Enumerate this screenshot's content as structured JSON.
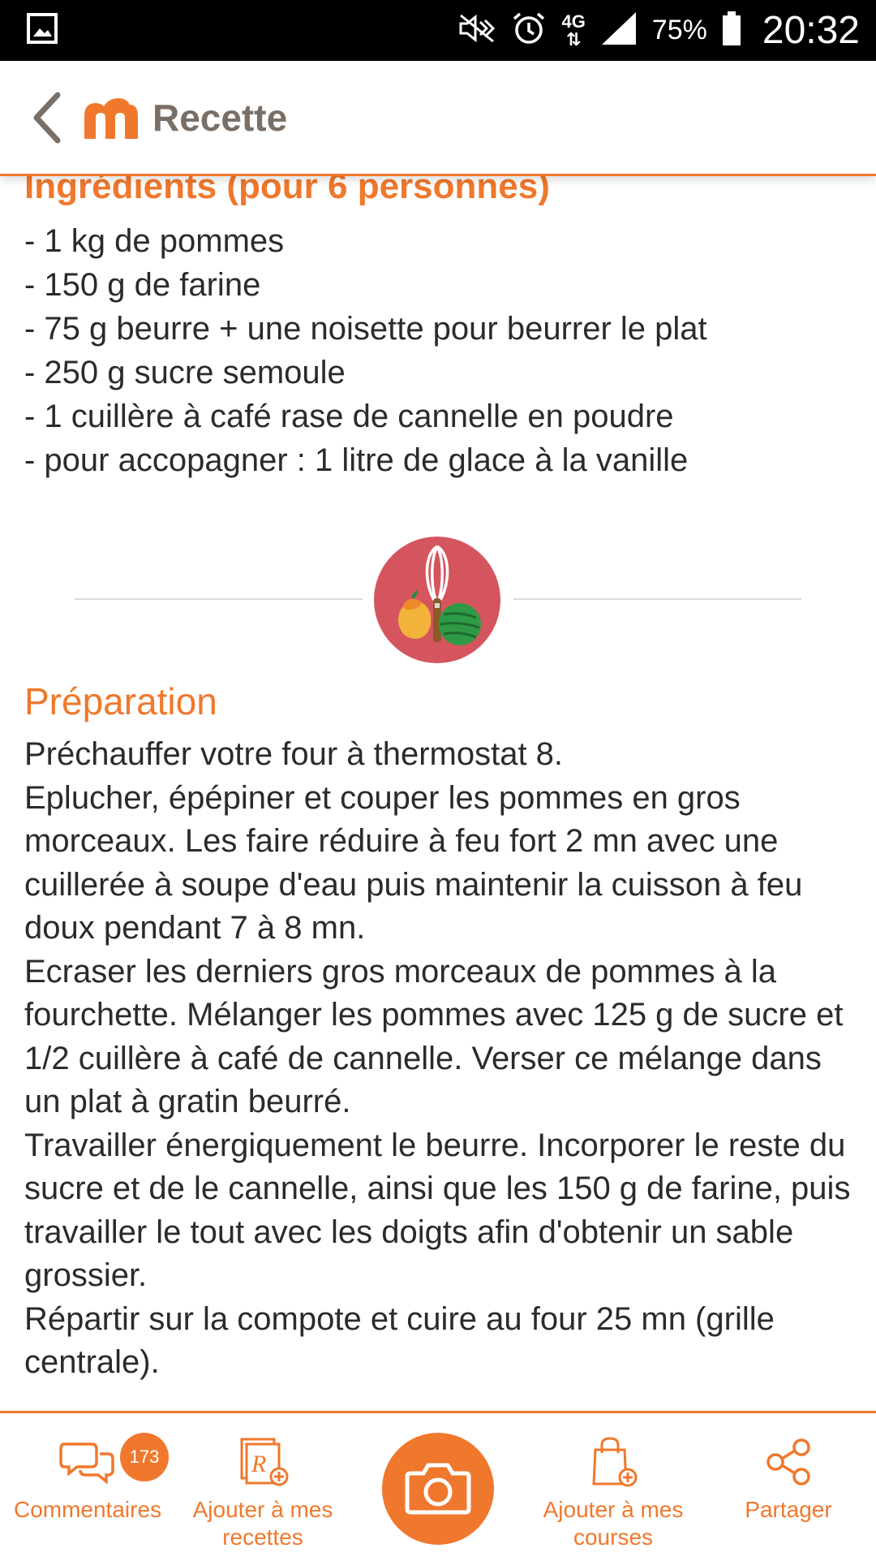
{
  "status_bar": {
    "battery": "75%",
    "time": "20:32",
    "network": "4G",
    "icons": [
      "gallery-icon",
      "mute-icon",
      "alarm-icon",
      "network-4g-icon",
      "signal-icon",
      "battery-icon"
    ]
  },
  "header": {
    "title": "Recette",
    "back_icon": "chevron-left-icon",
    "logo": "marmiton-logo"
  },
  "ingredients": {
    "title": "Ingrédients (pour 6 personnes)",
    "items": [
      "- 1 kg de pommes",
      "- 150 g de farine",
      "- 75 g beurre + une noisette pour beurrer le plat",
      "- 250 g sucre semoule",
      "- 1 cuillère à café rase de cannelle en poudre",
      "- pour accopagner : 1 litre de glace à la vanille"
    ]
  },
  "preparation": {
    "title": "Préparation",
    "icon": "whisk-fruit-icon",
    "steps": [
      "Préchauffer votre four à thermostat 8.",
      "Eplucher, épépiner et couper les pommes en gros morceaux. Les faire réduire à feu fort 2 mn avec une cuillerée à soupe d'eau puis maintenir la cuisson à feu doux pendant 7 à 8 mn.",
      "Ecraser les derniers gros morceaux de pommes à la fourchette. Mélanger les pommes avec 125 g de sucre et 1/2 cuillère à café de cannelle. Verser ce mélange dans un plat à gratin beurré.",
      "Travailler énergiquement le beurre. Incorporer le reste du sucre et de le cannelle, ainsi que les 150 g de farine, puis travailler le tout avec les doigts afin d'obtenir un sable grossier.",
      "Répartir sur la compote et cuire au four 25 mn (grille centrale)."
    ]
  },
  "bottom_bar": {
    "comments": {
      "label": "Commentaires",
      "badge": "173",
      "icon": "speech-bubbles-icon"
    },
    "add_recipes": {
      "label": "Ajouter à mes recettes",
      "icon": "recipe-add-icon"
    },
    "camera": {
      "icon": "camera-icon"
    },
    "add_shopping": {
      "label": "Ajouter à mes courses",
      "icon": "shopping-bag-add-icon"
    },
    "share": {
      "label": "Partager",
      "icon": "share-icon"
    }
  },
  "colors": {
    "accent": "#f0782c",
    "title_gray": "#7a6f67",
    "prep_circle": "#d5555f"
  }
}
